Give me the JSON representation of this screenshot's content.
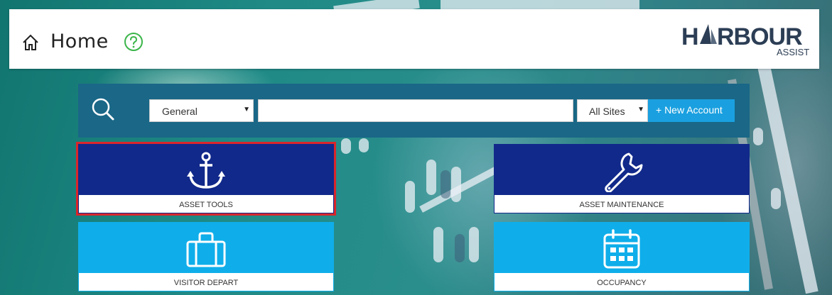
{
  "header": {
    "title": "Home",
    "help_icon": "help-circle-icon",
    "logo_text": "HARBOUR",
    "logo_sub": "ASSIST"
  },
  "search": {
    "category_selected": "General",
    "query": "",
    "site_selected": "All Sites",
    "new_account_label": "+ New Account"
  },
  "tiles": [
    {
      "label": "ASSET TOOLS",
      "icon": "anchor-icon",
      "color": "#11298a",
      "selected": true
    },
    {
      "label": "ASSET MAINTENANCE",
      "icon": "wrench-icon",
      "color": "#11298a",
      "selected": false
    },
    {
      "label": "VISITOR DEPART",
      "icon": "suitcase-icon",
      "color": "#0faeea",
      "selected": false
    },
    {
      "label": "OCCUPANCY",
      "icon": "calendar-icon",
      "color": "#0faeea",
      "selected": false
    }
  ],
  "colors": {
    "navy": "#11298a",
    "sky": "#0faeea",
    "search_bar": "#1a6787",
    "selection_outline": "#d9262b",
    "help_green": "#3cb54a"
  }
}
